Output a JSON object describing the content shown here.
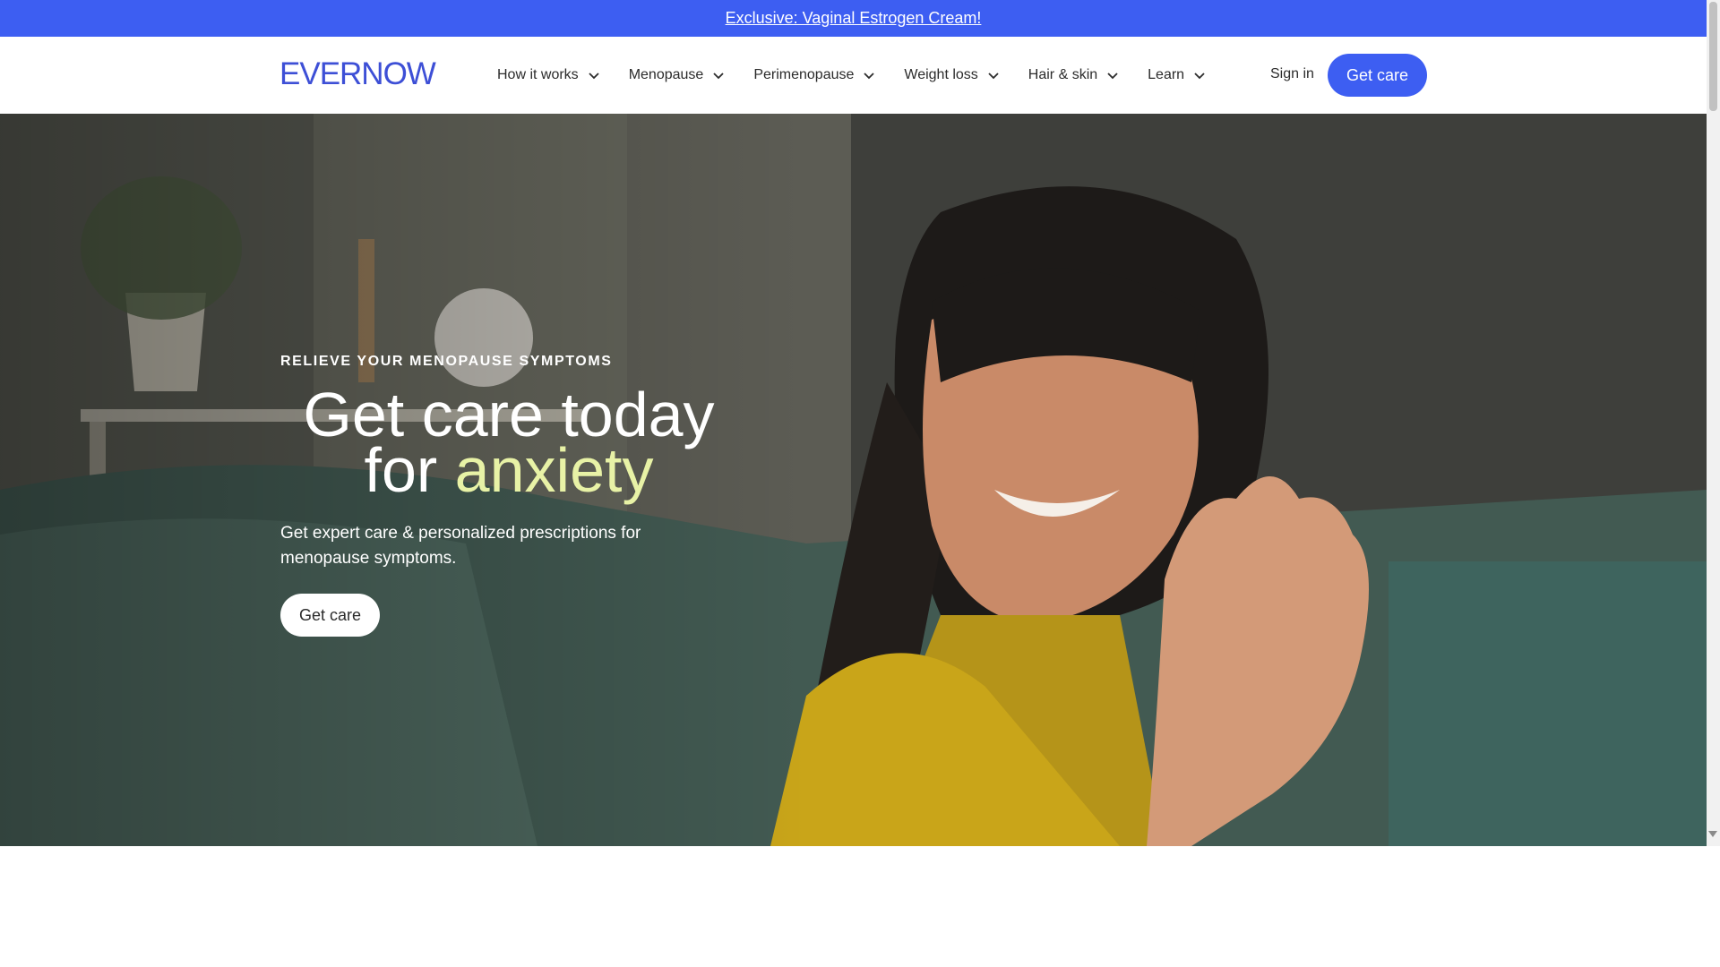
{
  "promo": {
    "text": "Exclusive: Vaginal Estrogen Cream!"
  },
  "brand": {
    "logo_text": "EVERNOW",
    "accent_color": "#3d5ef2",
    "highlight_color": "#e8f2a6"
  },
  "nav": {
    "items": [
      {
        "label": "How it works",
        "icon": "chevron-down-icon"
      },
      {
        "label": "Menopause",
        "icon": "chevron-down-icon"
      },
      {
        "label": "Perimenopause",
        "icon": "chevron-down-icon"
      },
      {
        "label": "Weight loss",
        "icon": "chevron-down-icon"
      },
      {
        "label": "Hair & skin",
        "icon": "chevron-down-icon"
      },
      {
        "label": "Learn",
        "icon": "chevron-down-icon"
      }
    ],
    "sign_in": "Sign in",
    "cta": "Get care"
  },
  "hero": {
    "eyebrow": "RELIEVE YOUR MENOPAUSE SYMPTOMS",
    "headline_line1": "Get care today",
    "headline_for": "for",
    "headline_accent": "anxiety",
    "subtext": "Get expert care & personalized prescriptions for menopause symptoms.",
    "cta": "Get care",
    "image": "woman-waving-photo"
  }
}
